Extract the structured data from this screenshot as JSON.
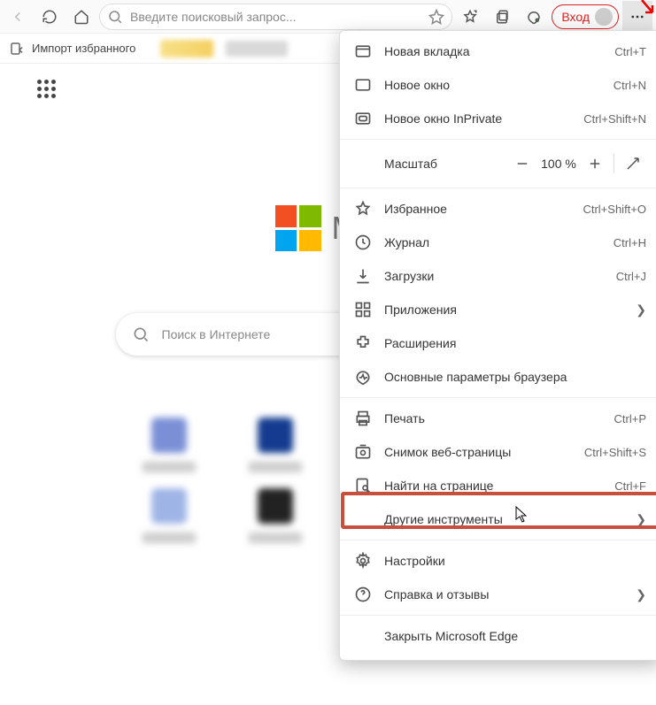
{
  "toolbar": {
    "search_placeholder": "Введите поисковый запрос...",
    "login_label": "Вход"
  },
  "bookmarks": {
    "import_label": "Импорт избранного"
  },
  "page": {
    "logo_text": "Mic",
    "search_placeholder": "Поиск в Интернете"
  },
  "menu": {
    "new_tab": "Новая вкладка",
    "new_tab_cut": "Ctrl+T",
    "new_window": "Новое окно",
    "new_window_cut": "Ctrl+N",
    "inprivate": "Новое окно InPrivate",
    "inprivate_cut": "Ctrl+Shift+N",
    "zoom_label": "Масштаб",
    "zoom_value": "100 %",
    "favorites": "Избранное",
    "favorites_cut": "Ctrl+Shift+O",
    "history": "Журнал",
    "history_cut": "Ctrl+H",
    "downloads": "Загрузки",
    "downloads_cut": "Ctrl+J",
    "apps": "Приложения",
    "extensions": "Расширения",
    "essentials": "Основные параметры браузера",
    "print": "Печать",
    "print_cut": "Ctrl+P",
    "screenshot": "Снимок веб-страницы",
    "screenshot_cut": "Ctrl+Shift+S",
    "find": "Найти на странице",
    "find_cut": "Ctrl+F",
    "more_tools": "Другие инструменты",
    "settings": "Настройки",
    "help": "Справка и отзывы",
    "close": "Закрыть Microsoft Edge"
  }
}
